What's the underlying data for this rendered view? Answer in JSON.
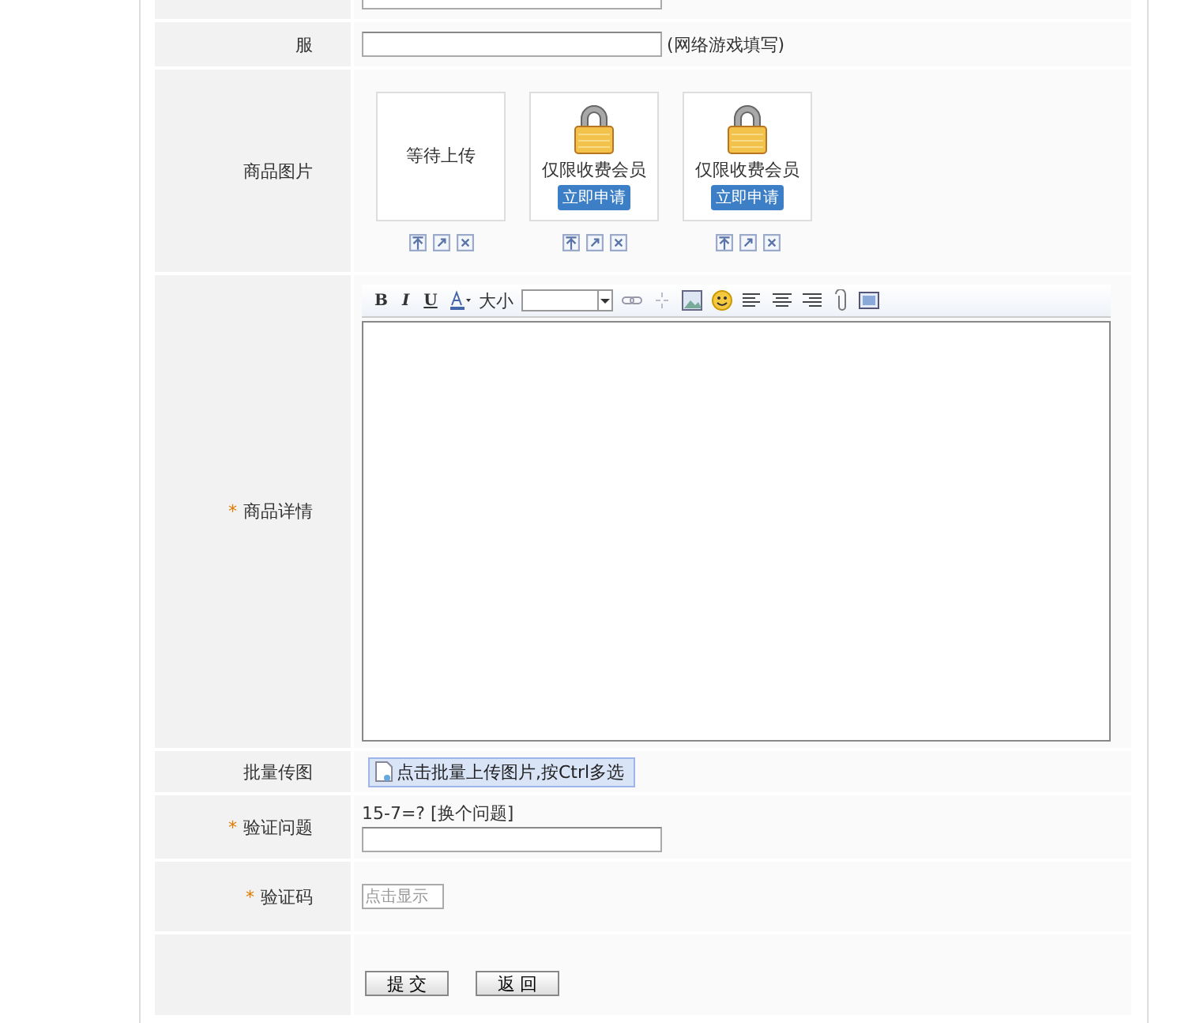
{
  "form": {
    "rows": [
      {
        "kind": "text"
      },
      {
        "kind": "text",
        "label": "服",
        "hint": "(网络游戏填写)"
      },
      {
        "kind": "images",
        "label": "商品图片",
        "slots": [
          {
            "kind": "pending",
            "text": "等待上传"
          },
          {
            "kind": "locked",
            "text": "仅限收费会员",
            "button": "立即申请"
          },
          {
            "kind": "locked",
            "text": "仅限收费会员",
            "button": "立即申请"
          }
        ]
      },
      {
        "kind": "editor",
        "label": "商品详情",
        "required_mark": "*",
        "format_buttons": [
          "B",
          "I",
          "U"
        ],
        "size_label": "大小"
      },
      {
        "kind": "upload",
        "label": "批量传图",
        "button": "点击批量上传图片,按Ctrl多选"
      },
      {
        "kind": "question",
        "label": "验证问题",
        "required_mark": "*",
        "question": "15-7=?",
        "link": "[换个问题]"
      },
      {
        "kind": "captcha",
        "label": "验证码",
        "required_mark": "*",
        "placeholder": "点击显示"
      },
      {
        "kind": "buttons",
        "buttons": [
          "提 交",
          "返 回"
        ]
      }
    ]
  }
}
